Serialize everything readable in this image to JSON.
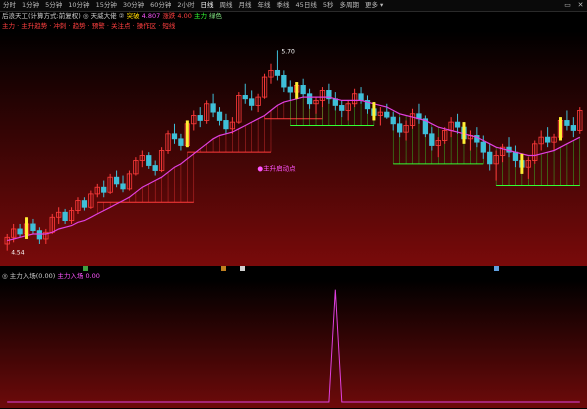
{
  "toolbar": {
    "periods": [
      "分时",
      "1分钟",
      "5分钟",
      "10分钟",
      "15分钟",
      "30分钟",
      "60分钟",
      "2小时",
      "日线",
      "周线",
      "月线",
      "年线",
      "季线",
      "45日线",
      "5秒",
      "多周期",
      "更多 ▾"
    ],
    "active_index": 8,
    "window_buttons": [
      "▭",
      "✕"
    ]
  },
  "main_header": {
    "title": "后浪天工(计算方式:前复权)",
    "indicator": "◎ 天威大佬 ②",
    "s1_label": "突破",
    "s1_value": "4.807",
    "s2_label": "涨跌",
    "s2_value": "4.00",
    "s3_label": "主力",
    "s3_value": "绿色"
  },
  "legend_line": {
    "text": "主力 · 主升趋势 · 冲刺 · 趋势 · 预警 · 关注点 · 操作区 · 短线"
  },
  "chart_labels": {
    "peak_price": "5.70",
    "low_price": "4.54",
    "annotation": "●主升启动点"
  },
  "sub_header": {
    "title": "◎ 主力入场(0.00)",
    "label": "主力入场",
    "value": "0.00"
  },
  "chart_data": {
    "type": "candlestick",
    "ma_color": "#e040e0",
    "up_color": "#ff3b3b",
    "down_color": "#3fbfd8",
    "bg_top": "#000000",
    "bg_bottom": "#7a0a0a",
    "candles": [
      [
        4.54,
        4.6,
        4.5,
        4.58
      ],
      [
        4.58,
        4.66,
        4.55,
        4.63
      ],
      [
        4.63,
        4.66,
        4.58,
        4.6
      ],
      [
        4.6,
        4.7,
        4.57,
        4.66
      ],
      [
        4.66,
        4.69,
        4.6,
        4.62
      ],
      [
        4.62,
        4.64,
        4.54,
        4.57
      ],
      [
        4.57,
        4.63,
        4.54,
        4.61
      ],
      [
        4.61,
        4.72,
        4.6,
        4.7
      ],
      [
        4.7,
        4.76,
        4.66,
        4.73
      ],
      [
        4.73,
        4.75,
        4.66,
        4.68
      ],
      [
        4.68,
        4.76,
        4.66,
        4.74
      ],
      [
        4.74,
        4.82,
        4.72,
        4.8
      ],
      [
        4.8,
        4.82,
        4.74,
        4.76
      ],
      [
        4.76,
        4.86,
        4.75,
        4.84
      ],
      [
        4.84,
        4.9,
        4.82,
        4.88
      ],
      [
        4.88,
        4.92,
        4.82,
        4.85
      ],
      [
        4.85,
        4.96,
        4.84,
        4.94
      ],
      [
        4.94,
        4.98,
        4.88,
        4.9
      ],
      [
        4.9,
        4.95,
        4.85,
        4.87
      ],
      [
        4.87,
        4.98,
        4.86,
        4.96
      ],
      [
        4.96,
        5.06,
        4.95,
        5.04
      ],
      [
        5.04,
        5.1,
        5.0,
        5.07
      ],
      [
        5.07,
        5.09,
        4.99,
        5.01
      ],
      [
        5.01,
        5.04,
        4.95,
        4.98
      ],
      [
        4.98,
        5.12,
        4.97,
        5.1
      ],
      [
        5.1,
        5.22,
        5.08,
        5.2
      ],
      [
        5.2,
        5.26,
        5.14,
        5.17
      ],
      [
        5.17,
        5.2,
        5.1,
        5.13
      ],
      [
        5.13,
        5.28,
        5.12,
        5.26
      ],
      [
        5.26,
        5.34,
        5.22,
        5.31
      ],
      [
        5.31,
        5.36,
        5.24,
        5.28
      ],
      [
        5.28,
        5.4,
        5.26,
        5.38
      ],
      [
        5.38,
        5.44,
        5.3,
        5.33
      ],
      [
        5.33,
        5.36,
        5.25,
        5.28
      ],
      [
        5.28,
        5.32,
        5.2,
        5.23
      ],
      [
        5.23,
        5.3,
        5.2,
        5.27
      ],
      [
        5.27,
        5.45,
        5.26,
        5.43
      ],
      [
        5.43,
        5.5,
        5.38,
        5.41
      ],
      [
        5.41,
        5.46,
        5.34,
        5.37
      ],
      [
        5.37,
        5.44,
        5.33,
        5.42
      ],
      [
        5.42,
        5.56,
        5.41,
        5.54
      ],
      [
        5.54,
        5.62,
        5.5,
        5.58
      ],
      [
        5.58,
        5.7,
        5.52,
        5.55
      ],
      [
        5.55,
        5.58,
        5.45,
        5.48
      ],
      [
        5.48,
        5.52,
        5.4,
        5.45
      ],
      [
        5.45,
        5.51,
        5.41,
        5.49
      ],
      [
        5.49,
        5.53,
        5.42,
        5.44
      ],
      [
        5.44,
        5.47,
        5.35,
        5.38
      ],
      [
        5.38,
        5.42,
        5.32,
        5.4
      ],
      [
        5.4,
        5.48,
        5.36,
        5.46
      ],
      [
        5.46,
        5.5,
        5.38,
        5.41
      ],
      [
        5.41,
        5.45,
        5.34,
        5.37
      ],
      [
        5.37,
        5.4,
        5.3,
        5.34
      ],
      [
        5.34,
        5.4,
        5.28,
        5.38
      ],
      [
        5.38,
        5.47,
        5.36,
        5.44
      ],
      [
        5.44,
        5.48,
        5.38,
        5.4
      ],
      [
        5.4,
        5.43,
        5.32,
        5.35
      ],
      [
        5.35,
        5.39,
        5.28,
        5.31
      ],
      [
        5.31,
        5.36,
        5.25,
        5.33
      ],
      [
        5.33,
        5.38,
        5.29,
        5.3
      ],
      [
        5.3,
        5.33,
        5.22,
        5.26
      ],
      [
        5.26,
        5.3,
        5.18,
        5.21
      ],
      [
        5.21,
        5.28,
        5.16,
        5.25
      ],
      [
        5.25,
        5.35,
        5.23,
        5.32
      ],
      [
        5.32,
        5.38,
        5.26,
        5.29
      ],
      [
        5.29,
        5.31,
        5.18,
        5.2
      ],
      [
        5.2,
        5.24,
        5.1,
        5.13
      ],
      [
        5.13,
        5.18,
        5.06,
        5.16
      ],
      [
        5.16,
        5.24,
        5.14,
        5.22
      ],
      [
        5.22,
        5.3,
        5.18,
        5.27
      ],
      [
        5.27,
        5.32,
        5.2,
        5.24
      ],
      [
        5.24,
        5.27,
        5.14,
        5.17
      ],
      [
        5.17,
        5.22,
        5.1,
        5.19
      ],
      [
        5.19,
        5.24,
        5.12,
        5.15
      ],
      [
        5.15,
        5.19,
        5.05,
        5.09
      ],
      [
        5.09,
        5.14,
        4.98,
        5.02
      ],
      [
        5.02,
        5.1,
        4.92,
        5.07
      ],
      [
        5.07,
        5.14,
        5.03,
        5.12
      ],
      [
        5.12,
        5.18,
        5.06,
        5.09
      ],
      [
        5.09,
        5.13,
        5.0,
        5.04
      ],
      [
        5.04,
        5.08,
        4.96,
        5.0
      ],
      [
        5.0,
        5.06,
        4.93,
        5.04
      ],
      [
        5.04,
        5.16,
        5.02,
        5.14
      ],
      [
        5.14,
        5.22,
        5.1,
        5.18
      ],
      [
        5.18,
        5.24,
        5.12,
        5.15
      ],
      [
        5.15,
        5.2,
        5.1,
        5.18
      ],
      [
        5.18,
        5.3,
        5.16,
        5.28
      ],
      [
        5.28,
        5.34,
        5.22,
        5.25
      ],
      [
        5.25,
        5.3,
        5.18,
        5.22
      ],
      [
        5.22,
        5.36,
        5.2,
        5.34
      ]
    ],
    "ma": [
      4.56,
      4.57,
      4.58,
      4.59,
      4.6,
      4.6,
      4.6,
      4.61,
      4.63,
      4.64,
      4.65,
      4.67,
      4.68,
      4.7,
      4.72,
      4.74,
      4.76,
      4.78,
      4.8,
      4.82,
      4.85,
      4.88,
      4.9,
      4.92,
      4.94,
      4.97,
      5.0,
      5.02,
      5.05,
      5.08,
      5.11,
      5.14,
      5.17,
      5.19,
      5.2,
      5.21,
      5.23,
      5.25,
      5.27,
      5.29,
      5.31,
      5.34,
      5.37,
      5.39,
      5.4,
      5.41,
      5.42,
      5.42,
      5.42,
      5.42,
      5.42,
      5.41,
      5.4,
      5.4,
      5.4,
      5.4,
      5.39,
      5.38,
      5.37,
      5.36,
      5.34,
      5.32,
      5.31,
      5.3,
      5.29,
      5.28,
      5.26,
      5.24,
      5.23,
      5.22,
      5.21,
      5.2,
      5.19,
      5.18,
      5.16,
      5.14,
      5.12,
      5.11,
      5.1,
      5.09,
      5.08,
      5.07,
      5.07,
      5.08,
      5.09,
      5.1,
      5.12,
      5.14,
      5.16,
      5.18
    ],
    "ylim": [
      4.45,
      5.78
    ],
    "sub_peak_index": 51,
    "sub_peak_value": 1.0,
    "sub_ylim": [
      0,
      1.05
    ]
  }
}
